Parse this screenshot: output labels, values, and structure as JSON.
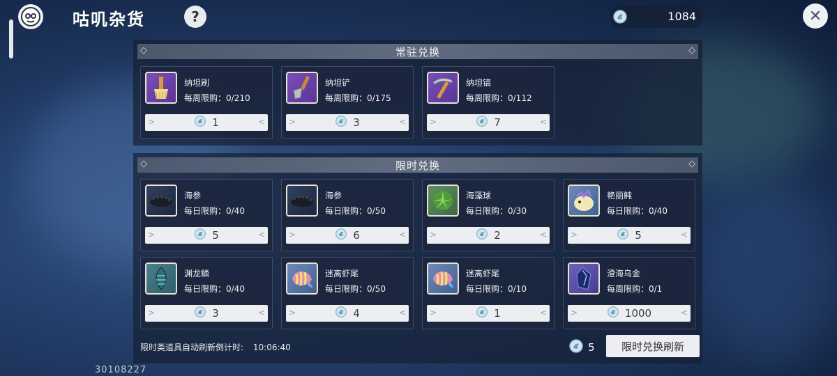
{
  "header": {
    "title": "咕叽杂货",
    "help_label": "?",
    "currency_amount": "1084",
    "close_label": "✕"
  },
  "sections": {
    "regular": {
      "title": "常驻兑换",
      "items": [
        {
          "name": "纳坦刷",
          "limit": "每周限购：0/210",
          "price": "1",
          "icon": "brush-icon",
          "bg": "purple"
        },
        {
          "name": "纳坦铲",
          "limit": "每周限购：0/175",
          "price": "3",
          "icon": "shovel-icon",
          "bg": "purple"
        },
        {
          "name": "纳坦镐",
          "limit": "每周限购：0/112",
          "price": "7",
          "icon": "pickaxe-icon",
          "bg": "purple"
        }
      ]
    },
    "limited": {
      "title": "限时兑换",
      "items": [
        {
          "name": "海参",
          "limit": "每日限购：0/40",
          "price": "5",
          "icon": "sea-cucumber-icon",
          "bg": "dark"
        },
        {
          "name": "海参",
          "limit": "每日限购：0/50",
          "price": "6",
          "icon": "sea-cucumber-icon",
          "bg": "dark"
        },
        {
          "name": "海藻球",
          "limit": "每日限购：0/30",
          "price": "2",
          "icon": "seaweed-ball-icon",
          "bg": "green"
        },
        {
          "name": "艳丽鲀",
          "limit": "每日限购：0/40",
          "price": "5",
          "icon": "pufferfish-icon",
          "bg": "blue"
        },
        {
          "name": "渊龙鳞",
          "limit": "每日限购：0/40",
          "price": "3",
          "icon": "dragon-scale-icon",
          "bg": "teal"
        },
        {
          "name": "迷离虾尾",
          "limit": "每日限购：0/50",
          "price": "4",
          "icon": "shrimp-tail-icon",
          "bg": "blue"
        },
        {
          "name": "迷离虾尾",
          "limit": "每日限购：0/10",
          "price": "1",
          "icon": "shrimp-tail-icon",
          "bg": "blue"
        },
        {
          "name": "澄海乌金",
          "limit": "每周限购：0/1",
          "price": "1000",
          "icon": "dark-gold-ore-icon",
          "bg": "violet"
        }
      ]
    }
  },
  "footer": {
    "refresh_note": "限时类道具自动刷新倒计时:",
    "timer": "10:06:40",
    "refresh_cost": "5",
    "refresh_button": "限时兑换刷新"
  },
  "uid": "30108227"
}
